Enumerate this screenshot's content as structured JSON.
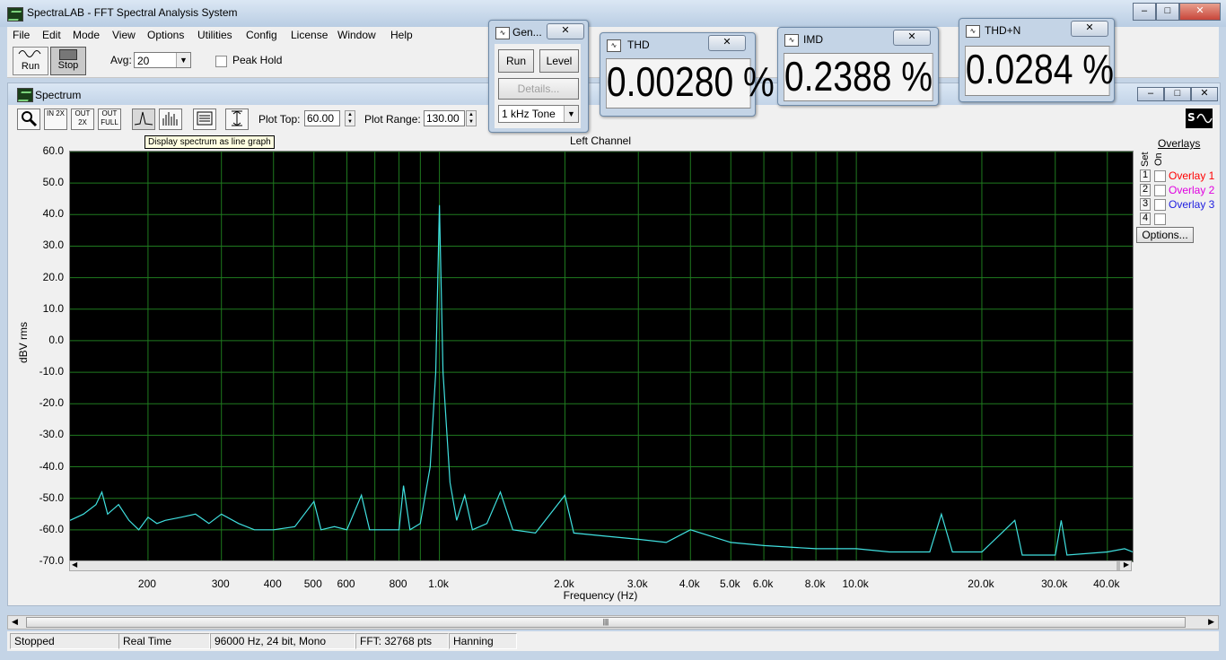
{
  "window": {
    "title": "SpectraLAB - FFT Spectral Analysis System",
    "min_label": "–",
    "max_label": "□",
    "close_label": "✕"
  },
  "menu": [
    "File",
    "Edit",
    "Mode",
    "View",
    "Options",
    "Utilities",
    "Config",
    "License",
    "Window",
    "Help"
  ],
  "toolbar": {
    "run_label": "Run",
    "stop_label": "Stop",
    "avg_label": "Avg:",
    "avg_value": "20",
    "peak_hold_label": "Peak Hold"
  },
  "spectrum": {
    "title": "Spectrum",
    "tools": [
      "zoom-icon",
      "zoom-in-2x-icon",
      "zoom-out-2x-icon",
      "zoom-out-full-icon",
      "line-graph-icon",
      "bar-graph-icon",
      "table-icon",
      "auto-scale-icon"
    ],
    "tool_labels": [
      "",
      "IN 2X",
      "OUT 2X",
      "OUT FULL",
      "",
      "",
      "",
      ""
    ],
    "plot_top_label": "Plot Top:",
    "plot_top_value": "60.00",
    "plot_range_label": "Plot Range:",
    "plot_range_value": "130.00",
    "tooltip": "Display spectrum as line graph",
    "overlays": {
      "title": "Overlays",
      "set_label": "Set",
      "on_label": "On",
      "items": [
        {
          "num": "1",
          "label": "Overlay 1",
          "color": "#ff0000"
        },
        {
          "num": "2",
          "label": "Overlay 2",
          "color": "#e000e0"
        },
        {
          "num": "3",
          "label": "Overlay 3",
          "color": "#2020e0"
        },
        {
          "num": "4",
          "label": "",
          "color": "#000000"
        }
      ],
      "options_label": "Options..."
    }
  },
  "chart_data": {
    "type": "line",
    "title": "Left Channel",
    "xlabel": "Frequency (Hz)",
    "ylabel": "dBV rms",
    "xscale": "log",
    "xlim": [
      130,
      46000
    ],
    "ylim": [
      -70,
      60
    ],
    "grid": true,
    "line_color": "#40e0e0",
    "yticks": [
      "60.0",
      "50.0",
      "40.0",
      "30.0",
      "20.0",
      "10.0",
      "0.0",
      "-10.0",
      "-20.0",
      "-30.0",
      "-40.0",
      "-50.0",
      "-60.0",
      "-70.0"
    ],
    "xticks": [
      {
        "label": "200",
        "value": 200
      },
      {
        "label": "300",
        "value": 300
      },
      {
        "label": "400",
        "value": 400
      },
      {
        "label": "500",
        "value": 500
      },
      {
        "label": "600",
        "value": 600
      },
      {
        "label": "800",
        "value": 800
      },
      {
        "label": "1.0k",
        "value": 1000
      },
      {
        "label": "2.0k",
        "value": 2000
      },
      {
        "label": "3.0k",
        "value": 3000
      },
      {
        "label": "4.0k",
        "value": 4000
      },
      {
        "label": "5.0k",
        "value": 5000
      },
      {
        "label": "6.0k",
        "value": 6000
      },
      {
        "label": "8.0k",
        "value": 8000
      },
      {
        "label": "10.0k",
        "value": 10000
      },
      {
        "label": "20.0k",
        "value": 20000
      },
      {
        "label": "30.0k",
        "value": 30000
      },
      {
        "label": "40.0k",
        "value": 40000
      }
    ],
    "series": [
      {
        "points": [
          [
            130,
            -57
          ],
          [
            140,
            -55
          ],
          [
            150,
            -52
          ],
          [
            155,
            -48
          ],
          [
            160,
            -55
          ],
          [
            170,
            -52
          ],
          [
            180,
            -57
          ],
          [
            190,
            -60
          ],
          [
            200,
            -56
          ],
          [
            210,
            -58
          ],
          [
            220,
            -57
          ],
          [
            240,
            -56
          ],
          [
            260,
            -55
          ],
          [
            280,
            -58
          ],
          [
            300,
            -55
          ],
          [
            330,
            -58
          ],
          [
            360,
            -60
          ],
          [
            400,
            -60
          ],
          [
            450,
            -59
          ],
          [
            500,
            -51
          ],
          [
            520,
            -60
          ],
          [
            560,
            -59
          ],
          [
            600,
            -60
          ],
          [
            650,
            -49
          ],
          [
            680,
            -60
          ],
          [
            750,
            -60
          ],
          [
            800,
            -60
          ],
          [
            820,
            -46
          ],
          [
            850,
            -60
          ],
          [
            900,
            -58
          ],
          [
            950,
            -40
          ],
          [
            980,
            -10
          ],
          [
            1000,
            43
          ],
          [
            1020,
            -10
          ],
          [
            1060,
            -45
          ],
          [
            1100,
            -57
          ],
          [
            1150,
            -49
          ],
          [
            1200,
            -60
          ],
          [
            1300,
            -58
          ],
          [
            1400,
            -48
          ],
          [
            1500,
            -60
          ],
          [
            1700,
            -61
          ],
          [
            2000,
            -49
          ],
          [
            2100,
            -61
          ],
          [
            2500,
            -62
          ],
          [
            3000,
            -63
          ],
          [
            3500,
            -64
          ],
          [
            4000,
            -60
          ],
          [
            5000,
            -64
          ],
          [
            6000,
            -65
          ],
          [
            8000,
            -66
          ],
          [
            10000,
            -66
          ],
          [
            12000,
            -67
          ],
          [
            15000,
            -67
          ],
          [
            16000,
            -55
          ],
          [
            17000,
            -67
          ],
          [
            20000,
            -67
          ],
          [
            24000,
            -57
          ],
          [
            25000,
            -68
          ],
          [
            30000,
            -68
          ],
          [
            31000,
            -57
          ],
          [
            32000,
            -68
          ],
          [
            40000,
            -67
          ],
          [
            44000,
            -66
          ],
          [
            46000,
            -67
          ]
        ]
      }
    ]
  },
  "status": [
    "Stopped",
    "Real Time",
    "96000 Hz, 24 bit, Mono",
    "FFT: 32768 pts",
    "Hanning"
  ],
  "generator": {
    "title": "Gen...",
    "run_label": "Run",
    "level_label": "Level",
    "details_label": "Details...",
    "tone_value": "1 kHz Tone"
  },
  "thd": {
    "title": "THD",
    "value": "0.00280 %"
  },
  "imd": {
    "title": "IMD",
    "value": "0.2388 %"
  },
  "thdn": {
    "title": "THD+N",
    "value": "0.0284 %"
  }
}
